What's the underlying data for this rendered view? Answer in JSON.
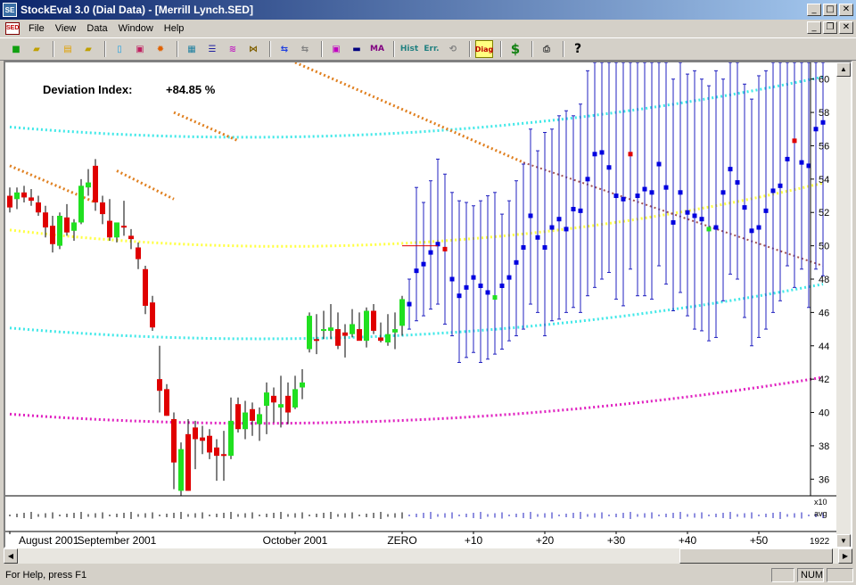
{
  "window": {
    "title": "StockEval 3.0  (Dial Data) - [Merrill Lynch.SED]",
    "app_icon": "SE"
  },
  "menu": {
    "doc_icon": "SED",
    "items": [
      {
        "label": "File",
        "u": "F"
      },
      {
        "label": "View",
        "u": "V"
      },
      {
        "label": "Data",
        "u": "D"
      },
      {
        "label": "Window",
        "u": "W"
      },
      {
        "label": "Help",
        "u": "H"
      }
    ]
  },
  "toolbar": {
    "hist_label": "Hist",
    "err_label": "Err.",
    "diag_label": "Diag",
    "ma_label": "MA"
  },
  "indicator": {
    "label": "Deviation Index:",
    "value": "+84.85 %"
  },
  "chart_data": {
    "type": "candlestick-with-projection",
    "y_axis": {
      "min": 35,
      "max": 61,
      "ticks": [
        36,
        38,
        40,
        42,
        44,
        46,
        48,
        50,
        52,
        54,
        56,
        58,
        60
      ]
    },
    "x_labels": [
      {
        "label": "August 2001",
        "pos": 0
      },
      {
        "label": "September 2001",
        "pos": 15
      },
      {
        "label": "October 2001",
        "pos": 40
      },
      {
        "label": "ZERO",
        "pos": 55
      },
      {
        "label": "+10",
        "pos": 65
      },
      {
        "label": "+20",
        "pos": 75
      },
      {
        "label": "+30",
        "pos": 85
      },
      {
        "label": "+40",
        "pos": 95
      },
      {
        "label": "+50",
        "pos": 105
      }
    ],
    "volume_scale": [
      "x10",
      "avg",
      "1922"
    ],
    "candles": [
      [
        53.0,
        53.5,
        52.0,
        52.3
      ],
      [
        52.8,
        53.5,
        52.2,
        53.2
      ],
      [
        53.2,
        53.6,
        52.6,
        52.9
      ],
      [
        52.9,
        53.4,
        52.4,
        52.7
      ],
      [
        52.6,
        53.0,
        51.8,
        52.0
      ],
      [
        52.0,
        52.4,
        50.5,
        51.1
      ],
      [
        51.2,
        51.8,
        49.6,
        50.1
      ],
      [
        50.0,
        52.0,
        49.8,
        51.8
      ],
      [
        51.7,
        52.5,
        50.6,
        50.8
      ],
      [
        50.9,
        51.6,
        50.3,
        51.4
      ],
      [
        51.4,
        54.0,
        51.3,
        53.6
      ],
      [
        53.5,
        54.6,
        53.0,
        53.8
      ],
      [
        54.8,
        55.2,
        52.1,
        52.6
      ],
      [
        52.6,
        53.0,
        51.3,
        51.9
      ],
      [
        51.5,
        52.8,
        50.3,
        50.5
      ],
      [
        50.5,
        51.4,
        50.2,
        51.4
      ],
      [
        51.2,
        52.7,
        50.6,
        51.1
      ],
      [
        50.6,
        51.0,
        49.8,
        50.4
      ],
      [
        49.9,
        50.2,
        48.6,
        49.2
      ],
      [
        48.6,
        48.8,
        45.9,
        46.4
      ],
      [
        46.6,
        47.0,
        44.9,
        45.1
      ],
      [
        42.0,
        44.0,
        40.0,
        41.3
      ],
      [
        41.4,
        41.7,
        39.8,
        39.8
      ],
      [
        39.6,
        40.0,
        35.4,
        37.0
      ],
      [
        35.3,
        38.2,
        35.0,
        37.8
      ],
      [
        38.7,
        39.6,
        35.3,
        35.3
      ],
      [
        39.1,
        39.5,
        36.6,
        38.4
      ],
      [
        38.5,
        39.2,
        37.5,
        38.3
      ],
      [
        38.6,
        39.0,
        37.2,
        37.6
      ],
      [
        37.9,
        38.4,
        35.9,
        37.4
      ],
      [
        37.5,
        38.9,
        35.9,
        37.4
      ],
      [
        37.4,
        40.9,
        37.2,
        39.5
      ],
      [
        40.5,
        40.9,
        38.8,
        39.0
      ],
      [
        39.0,
        40.7,
        38.4,
        40.0
      ],
      [
        40.2,
        40.6,
        38.6,
        39.5
      ],
      [
        39.3,
        40.3,
        38.3,
        39.9
      ],
      [
        40.4,
        41.8,
        38.7,
        41.2
      ],
      [
        41.0,
        41.5,
        39.4,
        40.6
      ],
      [
        40.3,
        42.2,
        39.1,
        40.5
      ],
      [
        41.0,
        41.8,
        39.3,
        40.0
      ],
      [
        40.3,
        42.2,
        40.2,
        41.4
      ],
      [
        41.5,
        42.6,
        40.8,
        41.8
      ],
      [
        43.8,
        46.0,
        43.6,
        45.8
      ],
      [
        44.4,
        45.9,
        43.5,
        44.3
      ],
      [
        44.9,
        46.1,
        44.4,
        45.0
      ],
      [
        44.9,
        46.5,
        44.4,
        45.1
      ],
      [
        45.0,
        46.0,
        43.8,
        44.0
      ],
      [
        44.8,
        45.3,
        43.3,
        44.6
      ],
      [
        44.7,
        46.2,
        44.5,
        45.3
      ],
      [
        45.0,
        46.0,
        44.5,
        44.3
      ],
      [
        44.3,
        46.3,
        43.9,
        46.1
      ],
      [
        46.1,
        46.5,
        44.7,
        44.9
      ],
      [
        44.5,
        45.4,
        44.2,
        44.3
      ],
      [
        44.2,
        45.9,
        44.0,
        44.7
      ],
      [
        44.8,
        46.0,
        43.8,
        45.0
      ],
      [
        45.2,
        47.0,
        44.6,
        46.8
      ]
    ],
    "projection": [
      [
        46.5,
        45.0,
        48.0,
        0
      ],
      [
        48.5,
        45.5,
        53.5,
        0
      ],
      [
        48.9,
        45.8,
        52.6,
        0
      ],
      [
        49.6,
        46.2,
        53.9,
        0
      ],
      [
        50.1,
        46.5,
        55.2,
        0
      ],
      [
        49.8,
        45.3,
        54.3,
        1
      ],
      [
        48.0,
        44.6,
        53.2,
        0
      ],
      [
        47.0,
        43.0,
        52.7,
        0
      ],
      [
        47.5,
        43.3,
        52.6,
        0
      ],
      [
        48.1,
        43.6,
        52.4,
        0
      ],
      [
        47.6,
        43.0,
        52.7,
        0
      ],
      [
        47.2,
        43.2,
        53.0,
        0
      ],
      [
        46.9,
        43.5,
        53.2,
        2
      ],
      [
        47.6,
        43.8,
        51.9,
        0
      ],
      [
        48.1,
        44.3,
        52.7,
        0
      ],
      [
        49.0,
        44.6,
        53.9,
        0
      ],
      [
        49.9,
        45.0,
        54.9,
        0
      ],
      [
        51.8,
        46.5,
        57.0,
        0
      ],
      [
        50.5,
        46.0,
        55.7,
        0
      ],
      [
        49.9,
        44.6,
        56.8,
        0
      ],
      [
        51.1,
        45.5,
        57.0,
        0
      ],
      [
        51.6,
        45.6,
        57.8,
        0
      ],
      [
        51.0,
        46.0,
        58.1,
        0
      ],
      [
        52.2,
        46.3,
        57.8,
        0
      ],
      [
        52.1,
        46.0,
        58.5,
        0
      ],
      [
        54.0,
        47.0,
        60.5,
        0
      ],
      [
        55.5,
        47.5,
        61.0,
        0
      ],
      [
        55.6,
        48.0,
        61.0,
        0
      ],
      [
        54.7,
        48.4,
        61.0,
        0
      ],
      [
        53.0,
        46.8,
        61.0,
        0
      ],
      [
        52.8,
        46.4,
        61.0,
        0
      ],
      [
        55.5,
        48.6,
        61.0,
        1
      ],
      [
        53.0,
        47.0,
        61.0,
        0
      ],
      [
        53.4,
        47.0,
        61.0,
        0
      ],
      [
        53.2,
        46.8,
        61.0,
        0
      ],
      [
        54.9,
        48.8,
        61.0,
        0
      ],
      [
        53.5,
        47.7,
        61.0,
        0
      ],
      [
        51.4,
        46.1,
        60.0,
        0
      ],
      [
        53.2,
        47.2,
        61.0,
        0
      ],
      [
        52.0,
        45.8,
        60.3,
        0
      ],
      [
        51.8,
        45.0,
        60.5,
        0
      ],
      [
        51.6,
        44.9,
        60.0,
        0
      ],
      [
        51.0,
        44.3,
        59.6,
        2
      ],
      [
        51.1,
        44.5,
        60.5,
        0
      ],
      [
        53.2,
        46.7,
        60.0,
        0
      ],
      [
        54.6,
        48.3,
        61.0,
        0
      ],
      [
        53.8,
        48.0,
        61.0,
        0
      ],
      [
        52.3,
        45.7,
        59.7,
        0
      ],
      [
        50.9,
        44.0,
        58.8,
        0
      ],
      [
        51.1,
        44.5,
        60.2,
        0
      ],
      [
        52.1,
        45.0,
        60.5,
        0
      ],
      [
        53.3,
        46.0,
        61.0,
        0
      ],
      [
        53.6,
        46.7,
        61.0,
        0
      ],
      [
        55.2,
        48.8,
        61.0,
        0
      ],
      [
        56.3,
        47.5,
        61.0,
        1
      ],
      [
        55.0,
        48.6,
        61.0,
        0
      ],
      [
        54.8,
        46.3,
        61.0,
        0
      ],
      [
        57.0,
        48.6,
        61.0,
        0
      ],
      [
        57.4,
        48.2,
        61.0,
        0
      ]
    ],
    "colors": {
      "up": "#20e020",
      "down": "#e00000",
      "projection": "#2020c0",
      "projection_mark": "#0000e0",
      "upper_band": "#40e8e8",
      "lower_band": "#40e8e8",
      "mid_band": "#ffff40",
      "low_band": "#e020c0",
      "trend": "#e08020"
    }
  },
  "status": {
    "help": "For Help, press F1",
    "num": "NUM"
  }
}
